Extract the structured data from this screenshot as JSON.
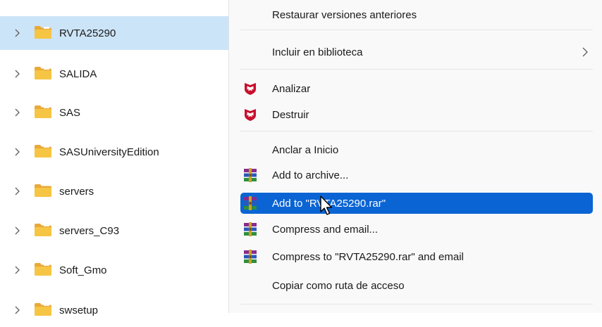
{
  "colors": {
    "selected_row": "#cce4f7",
    "menu_bg": "#f9f9f9",
    "highlight": "#0a64d4",
    "folder_yellow": "#f6c544",
    "mcafee_red": "#c8102e"
  },
  "tree": {
    "items": [
      {
        "label": "RVTA25290",
        "selected": true
      },
      {
        "label": "SALIDA"
      },
      {
        "label": "SAS"
      },
      {
        "label": "SASUniversityEdition"
      },
      {
        "label": "servers"
      },
      {
        "label": "servers_C93"
      },
      {
        "label": "Soft_Gmo"
      },
      {
        "label": "swsetup"
      }
    ]
  },
  "menu": {
    "items": [
      {
        "label": "Restaurar versiones anteriores"
      },
      {
        "label": "Incluir en biblioteca",
        "submenu": true
      },
      {
        "label": "Analizar",
        "icon": "mcafee-shield-icon"
      },
      {
        "label": "Destruir",
        "icon": "mcafee-shield-icon"
      },
      {
        "label": "Anclar a Inicio"
      },
      {
        "label": "Add to archive...",
        "icon": "winrar-icon"
      },
      {
        "label": "Add to \"RVTA25290.rar\"",
        "icon": "winrar-icon",
        "highlighted": true
      },
      {
        "label": "Compress and email...",
        "icon": "winrar-icon"
      },
      {
        "label": "Compress to \"RVTA25290.rar\" and email",
        "icon": "winrar-icon"
      },
      {
        "label": "Copiar como ruta de acceso"
      }
    ]
  }
}
